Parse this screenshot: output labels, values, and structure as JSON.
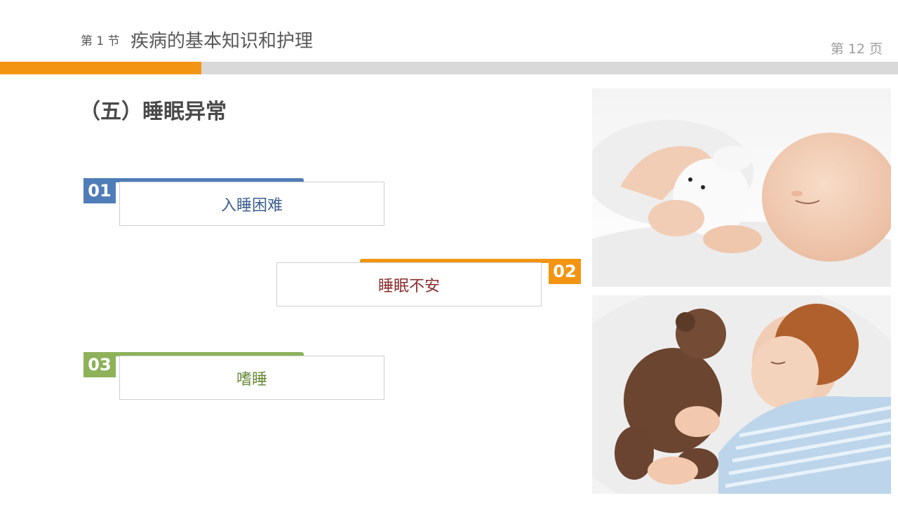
{
  "header": {
    "section": "第 1 节",
    "title": "疾病的基本知识和护理",
    "page": "第 12 页"
  },
  "progress": {
    "fraction": 0.224,
    "color": "#f39512"
  },
  "slide_title": "（五）睡眠异常",
  "items": [
    {
      "num": "01",
      "label": "入睡困难",
      "color": "#4f7db8",
      "text_color": "#3d5f8f"
    },
    {
      "num": "02",
      "label": "睡眠不安",
      "color": "#f39512",
      "text_color": "#8b2d2d"
    },
    {
      "num": "03",
      "label": "嗜睡",
      "color": "#8db25a",
      "text_color": "#6a8a3a"
    }
  ]
}
